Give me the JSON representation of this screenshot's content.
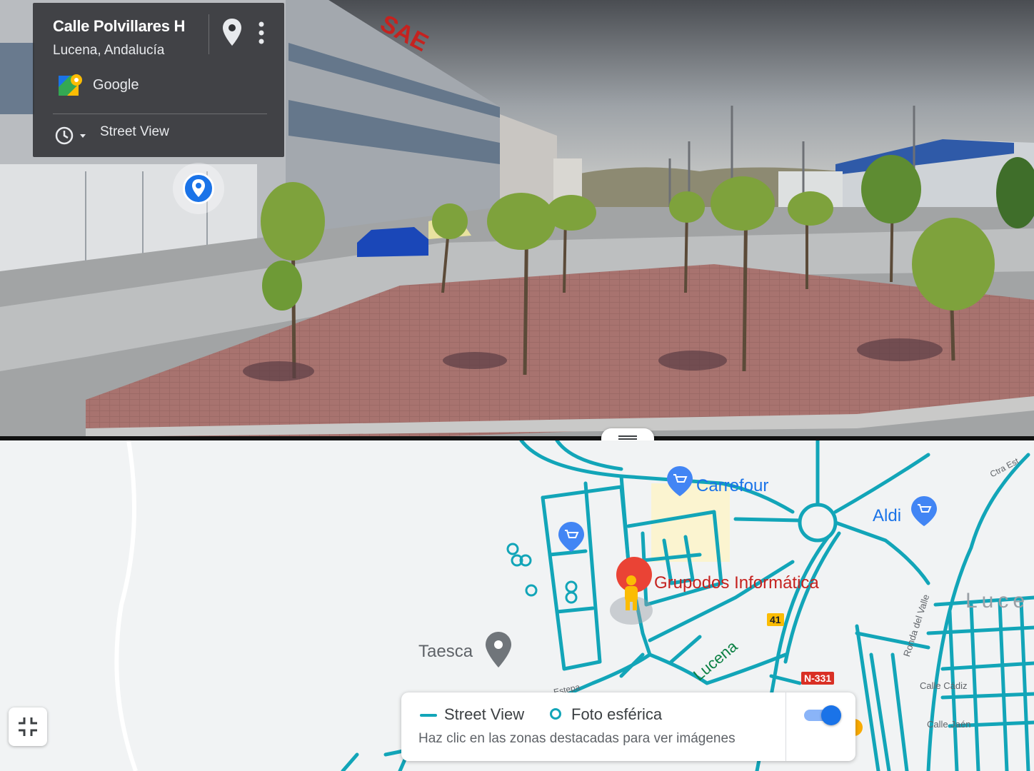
{
  "street_view": {
    "location_title": "Calle Polvillares H",
    "location_subtitle": "Lucena, Andalucía",
    "provider": "Google",
    "mode_label": "Street View",
    "building_sign": "SAE"
  },
  "map": {
    "places": {
      "carrefour": "Carrefour",
      "aldi": "Aldi",
      "selected": "Grupodos Informática",
      "taesca": "Taesca"
    },
    "area_label": "Luce",
    "roads": {
      "n331": "N-331",
      "a41": "41",
      "lucena": "Lucena",
      "cadiz": "Calle Cádiz",
      "jaen": "Calle Jaén",
      "ronda": "Ronda del Valle",
      "ctra": "Ctra Est",
      "estepa": "Estepa"
    },
    "street_view_color": "#12a5b8"
  },
  "legend": {
    "street_view_label": "Street View",
    "photo_sphere_label": "Foto esférica",
    "hint": "Haz clic en las zonas destacadas para ver imágenes",
    "coverage_toggle_on": true
  },
  "icons": {
    "pin": "pin-icon",
    "more": "more-vert-icon",
    "maps_logo": "google-maps-logo-icon",
    "history": "history-clock-icon",
    "collapse": "collapse-fullscreen-icon",
    "shopping": "shopping-cart-icon",
    "pegman": "pegman-icon"
  }
}
